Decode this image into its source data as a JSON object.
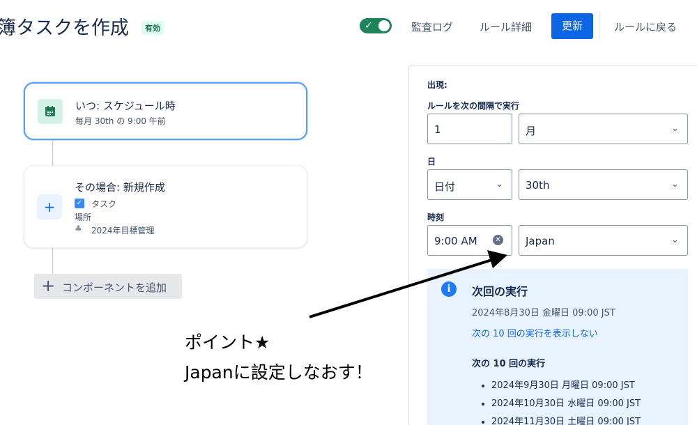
{
  "header": {
    "title": "簿タスクを作成",
    "status_badge": "有効",
    "audit_log": "監査ログ",
    "rule_details": "ルール詳細",
    "update": "更新",
    "back_to_rules": "ルールに戻る",
    "toggle_on": true
  },
  "canvas": {
    "when_card": {
      "title": "いつ: スケジュール時",
      "subtitle": "毎月 30th の 9:00 午前"
    },
    "then_card": {
      "title": "その場合: 新規作成",
      "type": "タスク",
      "location_label": "場所",
      "location_value": "2024年目標管理"
    },
    "add_component": "コンポーネントを追加"
  },
  "panel": {
    "occurrence_label": "出現:",
    "interval_label": "ルールを次の間隔で実行",
    "interval_value": "1",
    "interval_unit": "月",
    "day_label": "日",
    "day_type": "日付",
    "day_value": "30th",
    "time_label": "時刻",
    "time_value": "9:00 AM",
    "timezone": "Japan",
    "next_run": {
      "title": "次回の実行",
      "date": "2024年8月30日 金曜日 09:00 JST",
      "hide_link": "次の 10 回の実行を表示しない",
      "list_title": "次の 10 回の実行",
      "runs": [
        "2024年9月30日 月曜日 09:00 JST",
        "2024年10月30日 水曜日 09:00 JST",
        "2024年11月30日 土曜日 09:00 JST"
      ]
    }
  },
  "annotation": {
    "line1": "ポイント★",
    "line2": "Japanに設定しなおす！"
  },
  "colors": {
    "primary": "#0c66e4",
    "toggle": "#1f845a",
    "info_bg": "#e9f2ff",
    "badge_bg": "#dcfff1"
  }
}
